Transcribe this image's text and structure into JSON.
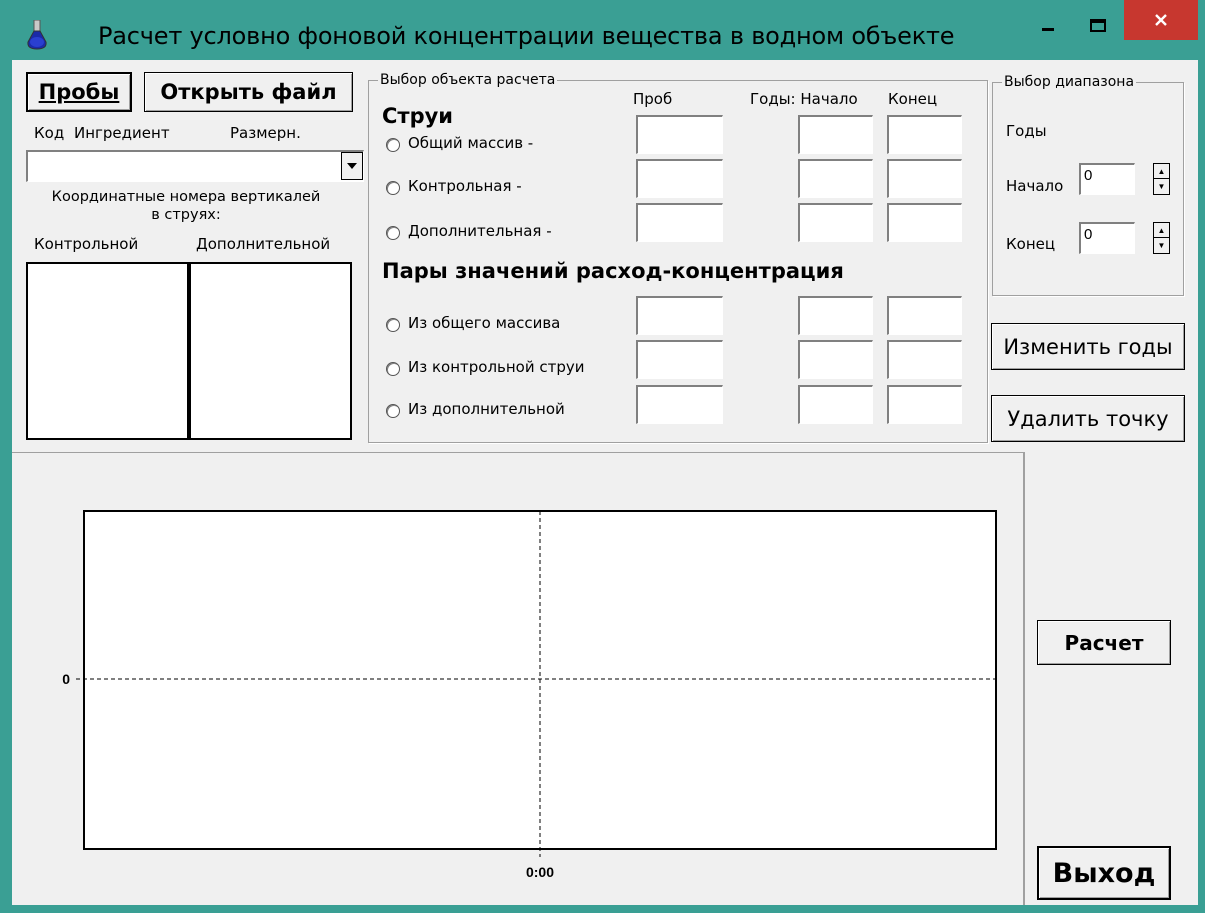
{
  "window": {
    "title": "Расчет условно фоновой концентрации вещества в водном объекте",
    "minimize_icon": "minimize-icon",
    "maximize_icon": "maximize-icon",
    "close_icon": "close-icon",
    "close_color": "#c7372f",
    "frame_color": "#3a9f94"
  },
  "left": {
    "probes_button": "Пробы",
    "open_file_button": "Открыть файл",
    "col_code": "Код",
    "col_ingredient": "Ингредиент",
    "col_units": "Размерн.",
    "ingredient_select_value": "",
    "coords_caption_line1": "Координатные номера вертикалей",
    "coords_caption_line2": "в струях:",
    "list_control_header": "Контрольной",
    "list_additional_header": "Дополнительной"
  },
  "calc_object": {
    "group_title": "Выбор объекта расчета",
    "col_probes": "Проб",
    "col_years_start": "Годы: Начало",
    "col_end": "Конец",
    "streams_heading": "Струи",
    "streams": [
      {
        "label": "Общий массив -"
      },
      {
        "label": "Контрольная -"
      },
      {
        "label": "Дополнительная -"
      }
    ],
    "pairs_heading": "Пары значений расход-концентрация",
    "pairs": [
      {
        "label": "Из общего массива"
      },
      {
        "label": "Из контрольной струи"
      },
      {
        "label": "Из дополнительной"
      }
    ]
  },
  "range": {
    "group_title": "Выбор диапазона",
    "years_label": "Годы",
    "start_label": "Начало",
    "start_value": "0",
    "end_label": "Конец",
    "end_value": "0"
  },
  "actions": {
    "change_years_button": "Изменить годы",
    "delete_point_button": "Удалить точку",
    "calc_button": "Расчет",
    "exit_button": "Выход"
  },
  "chart_data": {
    "type": "line",
    "title": "",
    "xlabel": "",
    "ylabel": "",
    "x_tick_labels": [
      "0:00"
    ],
    "y_tick_labels": [
      "0"
    ],
    "series": []
  }
}
